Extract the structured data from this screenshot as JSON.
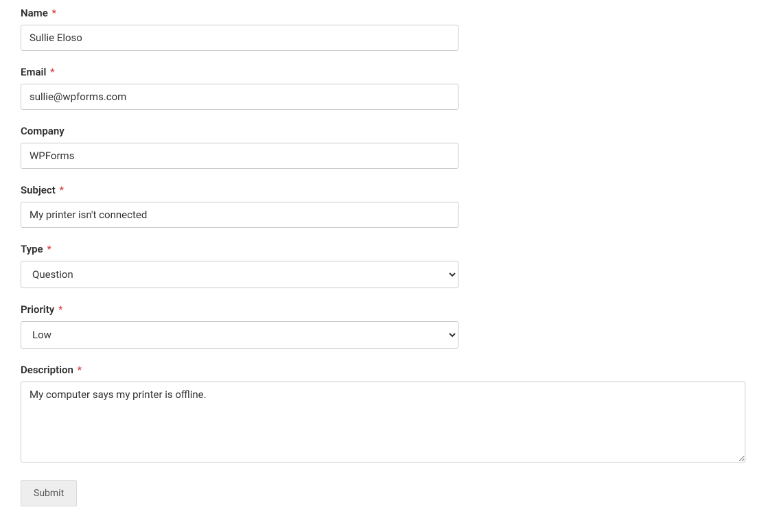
{
  "form": {
    "name": {
      "label": "Name",
      "required": true,
      "value": "Sullie Eloso"
    },
    "email": {
      "label": "Email",
      "required": true,
      "value": "sullie@wpforms.com"
    },
    "company": {
      "label": "Company",
      "required": false,
      "value": "WPForms"
    },
    "subject": {
      "label": "Subject",
      "required": true,
      "value": "My printer isn't connected"
    },
    "type": {
      "label": "Type",
      "required": true,
      "value": "Question"
    },
    "priority": {
      "label": "Priority",
      "required": true,
      "value": "Low"
    },
    "description": {
      "label": "Description",
      "required": true,
      "value": "My computer says my printer is offline."
    },
    "submit_label": "Submit",
    "required_marker": "*"
  }
}
